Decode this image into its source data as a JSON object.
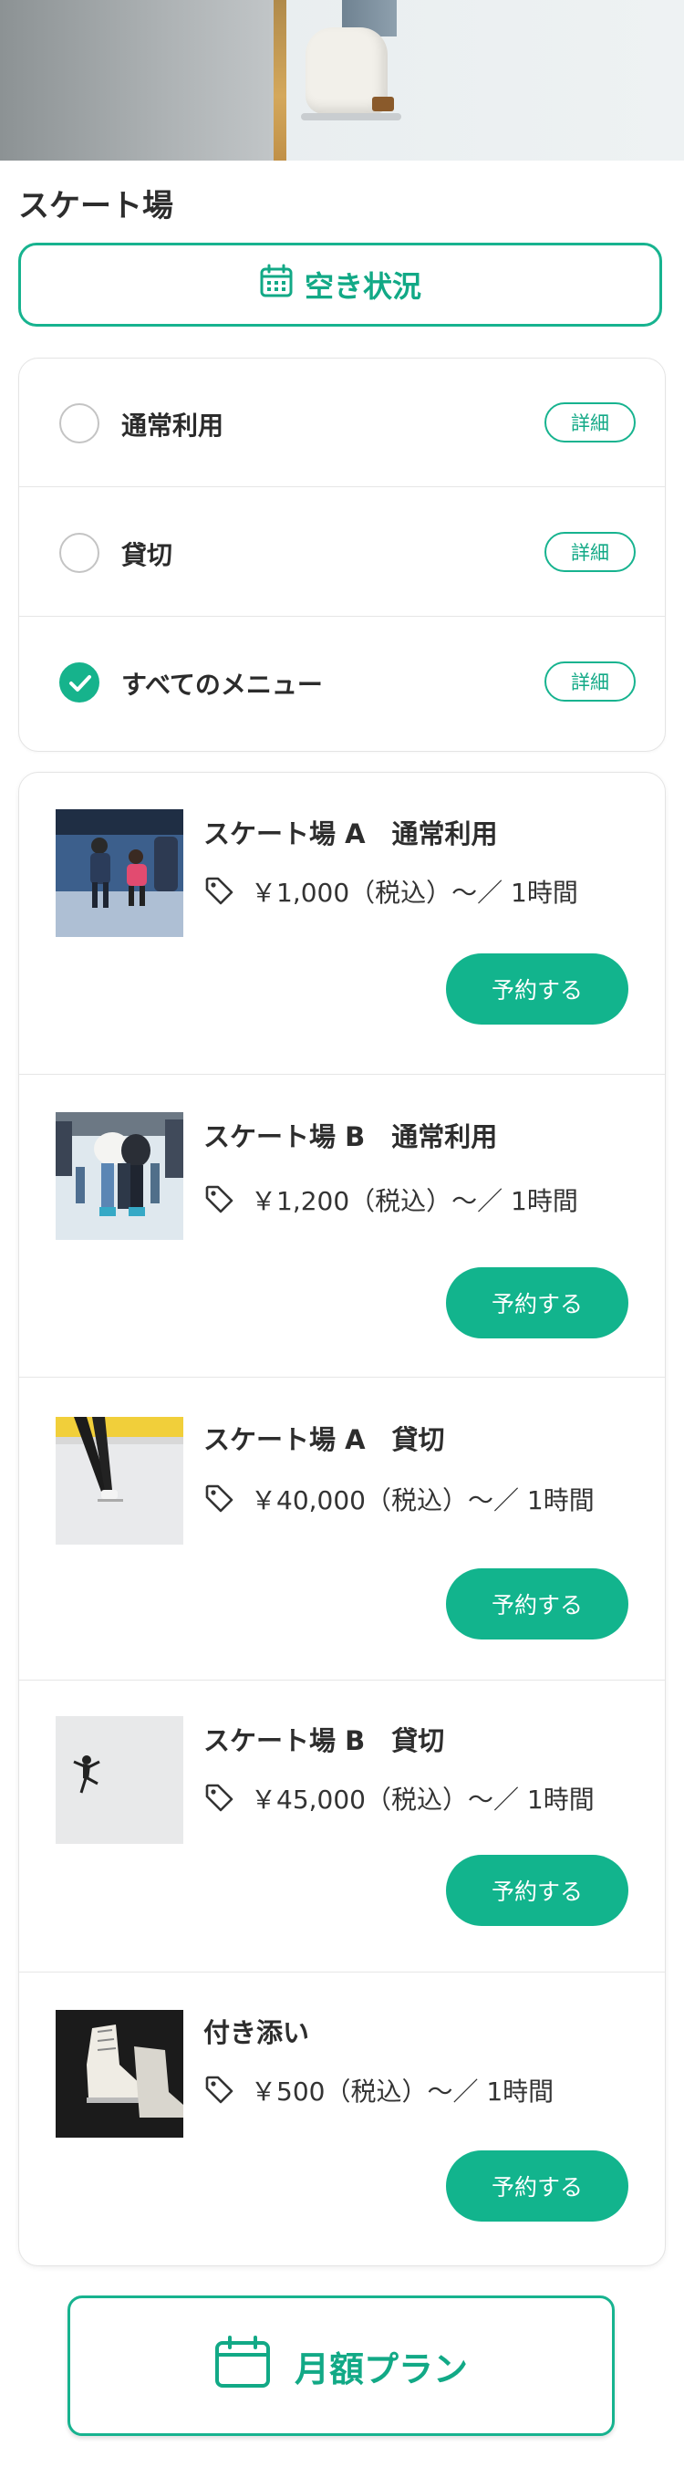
{
  "page": {
    "title": "スケート場"
  },
  "availability_button": {
    "label": "空き状況",
    "icon": "calendar-grid-icon"
  },
  "filters": [
    {
      "label": "通常利用",
      "detail": "詳細",
      "checked": false
    },
    {
      "label": "貸切",
      "detail": "詳細",
      "checked": false
    },
    {
      "label": "すべてのメニュー",
      "detail": "詳細",
      "checked": true
    }
  ],
  "items": [
    {
      "title": "スケート場 A　通常利用",
      "price": "￥1,000（税込）〜／ 1時間",
      "reserve": "予約する"
    },
    {
      "title": "スケート場 B　通常利用",
      "price": "￥1,200（税込）〜／ 1時間",
      "reserve": "予約する"
    },
    {
      "title": "スケート場 A　貸切",
      "price": "￥40,000（税込）〜／ 1時間",
      "reserve": "予約する"
    },
    {
      "title": "スケート場 B　貸切",
      "price": "￥45,000（税込）〜／ 1時間",
      "reserve": "予約する"
    },
    {
      "title": "付き添い",
      "price": "￥500（税込）〜／ 1時間",
      "reserve": "予約する"
    }
  ],
  "monthly_button": {
    "label": "月額プラン",
    "icon": "calendar-icon"
  },
  "colors": {
    "accent": "#12b48d",
    "text": "#2b2b2b",
    "border": "#e4e4e4"
  }
}
